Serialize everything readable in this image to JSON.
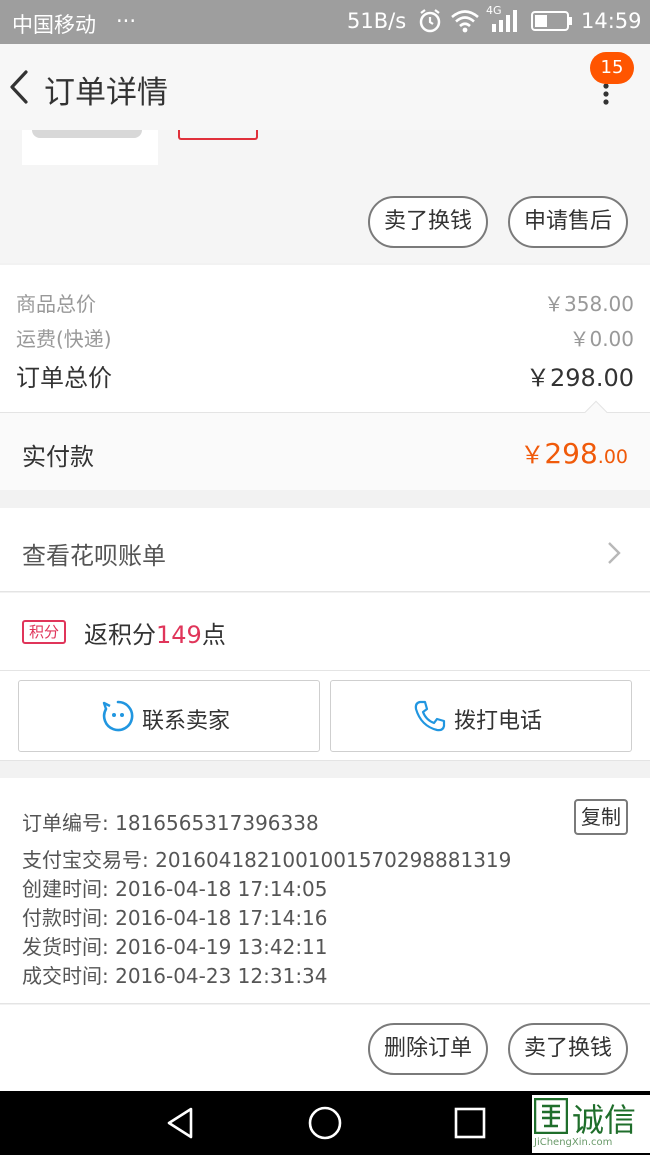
{
  "status_bar": {
    "carrier": "中国移动",
    "dots": "···",
    "net_speed": "51B/s",
    "network_type": "4G",
    "time": "14:59",
    "icons": [
      "alarm-icon",
      "wifi-icon",
      "signal-icon",
      "battery-icon"
    ],
    "background": "#9e9e9e"
  },
  "header": {
    "title": "订单详情",
    "notification_count": "15",
    "badge_color": "#ff5500"
  },
  "product": {
    "actions": {
      "resell_label": "卖了换钱",
      "after_sale_label": "申请售后"
    }
  },
  "price": {
    "goods_total_label": "商品总价",
    "goods_total_value": "￥358.00",
    "shipping_label": "运费(快递)",
    "shipping_value": "￥0.00",
    "order_total_label": "订单总价",
    "order_total_value": "￥298.00",
    "paid_label": "实付款",
    "paid_currency": "￥",
    "paid_integer": "298",
    "paid_decimal": ".00",
    "paid_color": "#f05a0a"
  },
  "huabei": {
    "label": "查看花呗账单"
  },
  "points": {
    "tag": "积分",
    "prefix": "返积分",
    "count": "149",
    "suffix": "点",
    "color": "#e0355a"
  },
  "contact": {
    "seller_label": "联系卖家",
    "phone_label": "拨打电话",
    "icon_color": "#2196e0"
  },
  "order_info": {
    "order_no": "订单编号: 1816565317396338",
    "alipay_no": "支付宝交易号: 2016041821001001570298881319",
    "created": "创建时间: 2016-04-18 17:14:05",
    "paid": "付款时间: 2016-04-18 17:14:16",
    "shipped": "发货时间: 2016-04-19 13:42:11",
    "completed": "成交时间: 2016-04-23 12:31:34",
    "copy_label": "复制"
  },
  "bottom_actions": {
    "delete_label": "删除订单",
    "resell_label": "卖了换钱"
  },
  "watermark": {
    "text": "诚信",
    "sub": "JiChengXin.com"
  }
}
